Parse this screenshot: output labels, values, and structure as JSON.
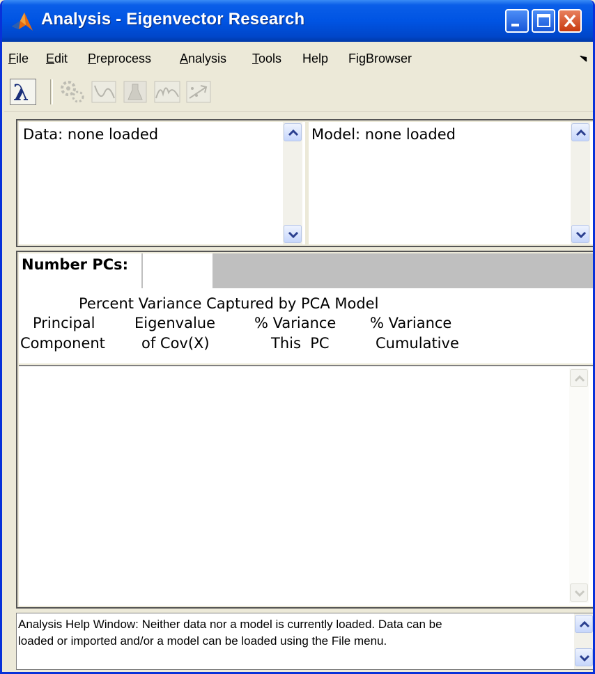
{
  "window": {
    "title": "Analysis - Eigenvector Research"
  },
  "menu": [
    {
      "label": "File",
      "mn": "F"
    },
    {
      "label": "Edit",
      "mn": "E"
    },
    {
      "label": "Preprocess",
      "mn": "P"
    },
    {
      "label": "Analysis",
      "mn": "A"
    },
    {
      "label": "Tools",
      "mn": "T"
    },
    {
      "label": "Help",
      "mn": ""
    },
    {
      "label": "FigBrowser",
      "mn": ""
    }
  ],
  "toolbar": {
    "items": [
      {
        "icon": "lambda-icon",
        "enabled": true
      },
      {
        "icon": "gears-icon",
        "enabled": false
      },
      {
        "icon": "curve-icon",
        "enabled": false
      },
      {
        "icon": "flask-icon",
        "enabled": false
      },
      {
        "icon": "spectrum-icon",
        "enabled": false
      },
      {
        "icon": "scatter-arrow-icon",
        "enabled": false
      }
    ]
  },
  "data_panel": {
    "label": "Data: none loaded"
  },
  "model_panel": {
    "label": "Model: none loaded"
  },
  "pcs": {
    "label": "Number PCs:",
    "value": ""
  },
  "variance": {
    "title": "Percent Variance Captured by PCA Model",
    "header_row1": [
      "Principal",
      "Eigenvalue",
      "% Variance",
      "% Variance"
    ],
    "header_row2": [
      "Component",
      "of Cov(X)",
      "This  PC",
      "Cumulative"
    ],
    "rows": []
  },
  "help": {
    "line1": "Analysis Help Window: Neither data nor a model is currently loaded. Data can be",
    "line2": "loaded or imported and/or a model can be loaded using the File menu."
  },
  "colors": {
    "titlebar": "#0054e3",
    "chrome": "#ece9d8",
    "pcs_bar": "#bfbfbf"
  }
}
